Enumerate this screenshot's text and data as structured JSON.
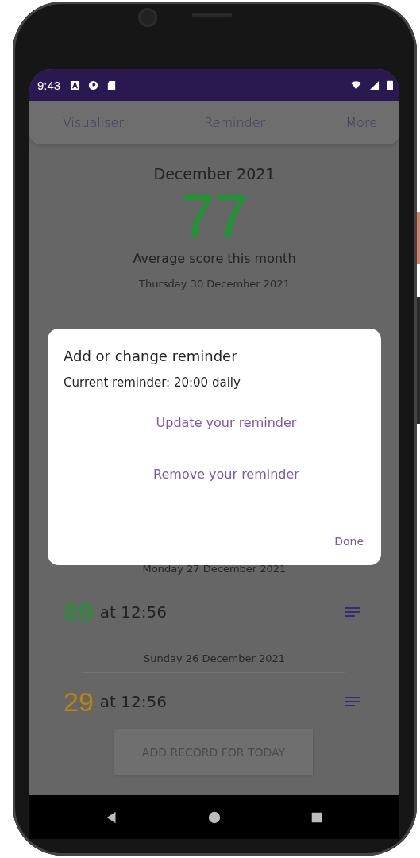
{
  "status_bar": {
    "time": "9:43"
  },
  "tabs": [
    {
      "label": "Visualiser",
      "selected": false
    },
    {
      "label": "Reminder",
      "selected": false
    },
    {
      "label": "More",
      "selected": false
    }
  ],
  "summary": {
    "month": "December 2021",
    "average": "77",
    "color": "#1a9a2e",
    "caption": "Average score this month"
  },
  "days": [
    {
      "date": "Thursday 30 December 2021"
    },
    {
      "date": "Monday 27 December 2021",
      "entries": [
        {
          "score": "89",
          "color": "#1a9a2e",
          "time": "at 12:56"
        }
      ]
    },
    {
      "date": "Sunday 26 December 2021",
      "entries": [
        {
          "score": "29",
          "color": "#b8860b",
          "time": "at 12:56"
        }
      ]
    }
  ],
  "add_button": {
    "label": "ADD RECORD FOR TODAY"
  },
  "dialog": {
    "title": "Add or change reminder",
    "current": "Current reminder: 20:00 daily",
    "actions": [
      "Update your reminder",
      "Remove your reminder"
    ],
    "done": "Done"
  }
}
